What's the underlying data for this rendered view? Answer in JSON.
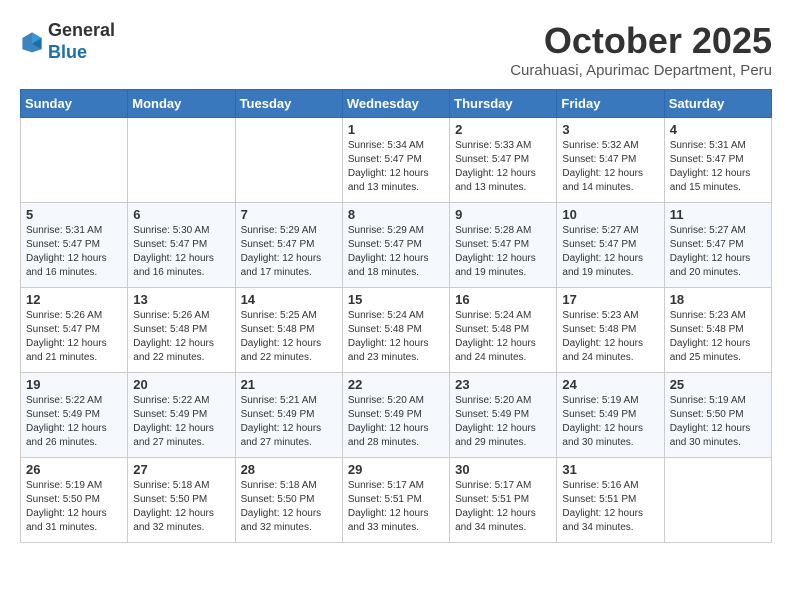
{
  "header": {
    "logo_general": "General",
    "logo_blue": "Blue",
    "month_title": "October 2025",
    "subtitle": "Curahuasi, Apurimac Department, Peru"
  },
  "weekdays": [
    "Sunday",
    "Monday",
    "Tuesday",
    "Wednesday",
    "Thursday",
    "Friday",
    "Saturday"
  ],
  "weeks": [
    [
      {
        "day": "",
        "sunrise": "",
        "sunset": "",
        "daylight": ""
      },
      {
        "day": "",
        "sunrise": "",
        "sunset": "",
        "daylight": ""
      },
      {
        "day": "",
        "sunrise": "",
        "sunset": "",
        "daylight": ""
      },
      {
        "day": "1",
        "sunrise": "Sunrise: 5:34 AM",
        "sunset": "Sunset: 5:47 PM",
        "daylight": "Daylight: 12 hours and 13 minutes."
      },
      {
        "day": "2",
        "sunrise": "Sunrise: 5:33 AM",
        "sunset": "Sunset: 5:47 PM",
        "daylight": "Daylight: 12 hours and 13 minutes."
      },
      {
        "day": "3",
        "sunrise": "Sunrise: 5:32 AM",
        "sunset": "Sunset: 5:47 PM",
        "daylight": "Daylight: 12 hours and 14 minutes."
      },
      {
        "day": "4",
        "sunrise": "Sunrise: 5:31 AM",
        "sunset": "Sunset: 5:47 PM",
        "daylight": "Daylight: 12 hours and 15 minutes."
      }
    ],
    [
      {
        "day": "5",
        "sunrise": "Sunrise: 5:31 AM",
        "sunset": "Sunset: 5:47 PM",
        "daylight": "Daylight: 12 hours and 16 minutes."
      },
      {
        "day": "6",
        "sunrise": "Sunrise: 5:30 AM",
        "sunset": "Sunset: 5:47 PM",
        "daylight": "Daylight: 12 hours and 16 minutes."
      },
      {
        "day": "7",
        "sunrise": "Sunrise: 5:29 AM",
        "sunset": "Sunset: 5:47 PM",
        "daylight": "Daylight: 12 hours and 17 minutes."
      },
      {
        "day": "8",
        "sunrise": "Sunrise: 5:29 AM",
        "sunset": "Sunset: 5:47 PM",
        "daylight": "Daylight: 12 hours and 18 minutes."
      },
      {
        "day": "9",
        "sunrise": "Sunrise: 5:28 AM",
        "sunset": "Sunset: 5:47 PM",
        "daylight": "Daylight: 12 hours and 19 minutes."
      },
      {
        "day": "10",
        "sunrise": "Sunrise: 5:27 AM",
        "sunset": "Sunset: 5:47 PM",
        "daylight": "Daylight: 12 hours and 19 minutes."
      },
      {
        "day": "11",
        "sunrise": "Sunrise: 5:27 AM",
        "sunset": "Sunset: 5:47 PM",
        "daylight": "Daylight: 12 hours and 20 minutes."
      }
    ],
    [
      {
        "day": "12",
        "sunrise": "Sunrise: 5:26 AM",
        "sunset": "Sunset: 5:47 PM",
        "daylight": "Daylight: 12 hours and 21 minutes."
      },
      {
        "day": "13",
        "sunrise": "Sunrise: 5:26 AM",
        "sunset": "Sunset: 5:48 PM",
        "daylight": "Daylight: 12 hours and 22 minutes."
      },
      {
        "day": "14",
        "sunrise": "Sunrise: 5:25 AM",
        "sunset": "Sunset: 5:48 PM",
        "daylight": "Daylight: 12 hours and 22 minutes."
      },
      {
        "day": "15",
        "sunrise": "Sunrise: 5:24 AM",
        "sunset": "Sunset: 5:48 PM",
        "daylight": "Daylight: 12 hours and 23 minutes."
      },
      {
        "day": "16",
        "sunrise": "Sunrise: 5:24 AM",
        "sunset": "Sunset: 5:48 PM",
        "daylight": "Daylight: 12 hours and 24 minutes."
      },
      {
        "day": "17",
        "sunrise": "Sunrise: 5:23 AM",
        "sunset": "Sunset: 5:48 PM",
        "daylight": "Daylight: 12 hours and 24 minutes."
      },
      {
        "day": "18",
        "sunrise": "Sunrise: 5:23 AM",
        "sunset": "Sunset: 5:48 PM",
        "daylight": "Daylight: 12 hours and 25 minutes."
      }
    ],
    [
      {
        "day": "19",
        "sunrise": "Sunrise: 5:22 AM",
        "sunset": "Sunset: 5:49 PM",
        "daylight": "Daylight: 12 hours and 26 minutes."
      },
      {
        "day": "20",
        "sunrise": "Sunrise: 5:22 AM",
        "sunset": "Sunset: 5:49 PM",
        "daylight": "Daylight: 12 hours and 27 minutes."
      },
      {
        "day": "21",
        "sunrise": "Sunrise: 5:21 AM",
        "sunset": "Sunset: 5:49 PM",
        "daylight": "Daylight: 12 hours and 27 minutes."
      },
      {
        "day": "22",
        "sunrise": "Sunrise: 5:20 AM",
        "sunset": "Sunset: 5:49 PM",
        "daylight": "Daylight: 12 hours and 28 minutes."
      },
      {
        "day": "23",
        "sunrise": "Sunrise: 5:20 AM",
        "sunset": "Sunset: 5:49 PM",
        "daylight": "Daylight: 12 hours and 29 minutes."
      },
      {
        "day": "24",
        "sunrise": "Sunrise: 5:19 AM",
        "sunset": "Sunset: 5:49 PM",
        "daylight": "Daylight: 12 hours and 30 minutes."
      },
      {
        "day": "25",
        "sunrise": "Sunrise: 5:19 AM",
        "sunset": "Sunset: 5:50 PM",
        "daylight": "Daylight: 12 hours and 30 minutes."
      }
    ],
    [
      {
        "day": "26",
        "sunrise": "Sunrise: 5:19 AM",
        "sunset": "Sunset: 5:50 PM",
        "daylight": "Daylight: 12 hours and 31 minutes."
      },
      {
        "day": "27",
        "sunrise": "Sunrise: 5:18 AM",
        "sunset": "Sunset: 5:50 PM",
        "daylight": "Daylight: 12 hours and 32 minutes."
      },
      {
        "day": "28",
        "sunrise": "Sunrise: 5:18 AM",
        "sunset": "Sunset: 5:50 PM",
        "daylight": "Daylight: 12 hours and 32 minutes."
      },
      {
        "day": "29",
        "sunrise": "Sunrise: 5:17 AM",
        "sunset": "Sunset: 5:51 PM",
        "daylight": "Daylight: 12 hours and 33 minutes."
      },
      {
        "day": "30",
        "sunrise": "Sunrise: 5:17 AM",
        "sunset": "Sunset: 5:51 PM",
        "daylight": "Daylight: 12 hours and 34 minutes."
      },
      {
        "day": "31",
        "sunrise": "Sunrise: 5:16 AM",
        "sunset": "Sunset: 5:51 PM",
        "daylight": "Daylight: 12 hours and 34 minutes."
      },
      {
        "day": "",
        "sunrise": "",
        "sunset": "",
        "daylight": ""
      }
    ]
  ]
}
